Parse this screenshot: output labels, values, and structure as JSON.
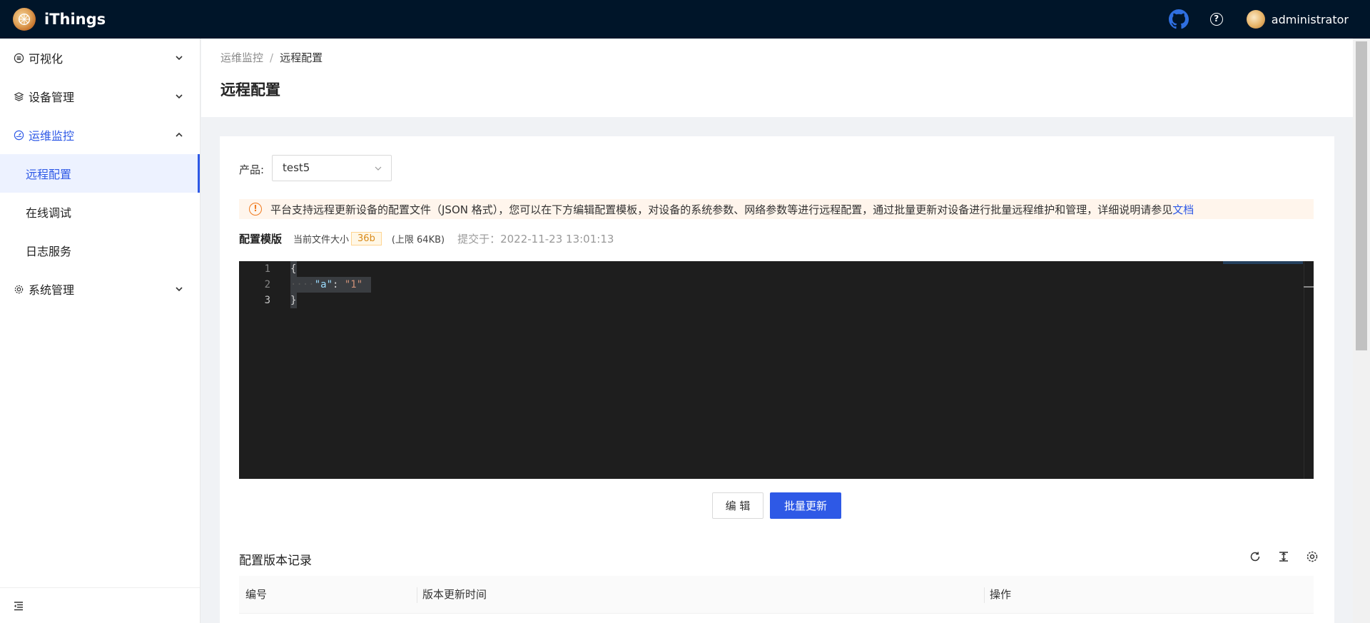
{
  "app": {
    "name": "iThings"
  },
  "header": {
    "user": "administrator"
  },
  "sidebar": {
    "items": [
      {
        "label": "可视化"
      },
      {
        "label": "设备管理"
      },
      {
        "label": "运维监控"
      },
      {
        "label": "系统管理"
      }
    ],
    "sub_items": [
      {
        "label": "远程配置"
      },
      {
        "label": "在线调试"
      },
      {
        "label": "日志服务"
      }
    ]
  },
  "breadcrumb": {
    "parent": "运维监控",
    "separator": "/",
    "current": "远程配置"
  },
  "page": {
    "title": "远程配置"
  },
  "product": {
    "label": "产品:",
    "value": "test5"
  },
  "alert": {
    "text": "平台支持远程更新设备的配置文件（JSON 格式），您可以在下方编辑配置模板，对设备的系统参数、网络参数等进行远程配置，通过批量更新对设备进行批量远程维护和管理，详细说明请参见",
    "link": "文档"
  },
  "template": {
    "title": "配置模版",
    "size_label": "当前文件大小",
    "size": "36b",
    "limit": "(上限 64KB)",
    "submitted": "提交于：2022-11-23 13:01:13"
  },
  "editor": {
    "line_numbers": [
      "1",
      "2",
      "3"
    ],
    "line1": "{",
    "indent": "····",
    "key": "\"a\"",
    "colon": ": ",
    "value": "\"1\"",
    "line3": "}"
  },
  "buttons": {
    "edit": "编 辑",
    "batch_update": "批量更新"
  },
  "history": {
    "title": "配置版本记录",
    "columns": [
      "编号",
      "版本更新时间",
      "操作"
    ]
  },
  "colors": {
    "primary": "#2e59e6",
    "header_bg": "#001529",
    "warning": "#f07a1f"
  }
}
